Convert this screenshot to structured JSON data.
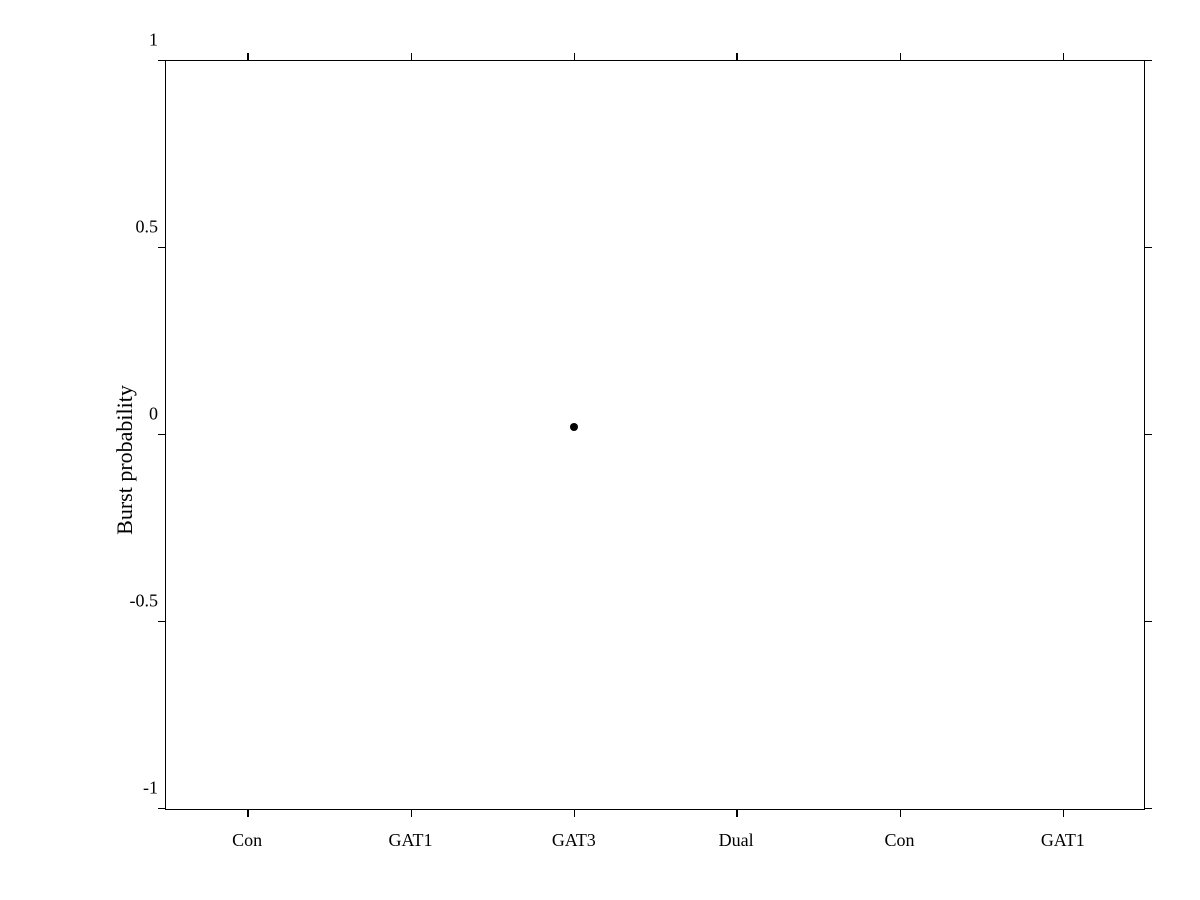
{
  "chart": {
    "y_axis_label": "Burst probability",
    "y_ticks": [
      {
        "value": 1,
        "label": "1"
      },
      {
        "value": 0.5,
        "label": "0.5"
      },
      {
        "value": 0,
        "label": "0"
      },
      {
        "value": -0.5,
        "label": "-0.5"
      },
      {
        "value": -1,
        "label": "-1"
      }
    ],
    "x_ticks": [
      {
        "label": "Con",
        "position_pct": 8.3
      },
      {
        "label": "GAT1",
        "position_pct": 25
      },
      {
        "label": "GAT3",
        "position_pct": 41.7
      },
      {
        "label": "Dual",
        "position_pct": 58.3
      },
      {
        "label": "Con",
        "position_pct": 75
      },
      {
        "label": "GAT1",
        "position_pct": 91.7
      }
    ],
    "data_points": [
      {
        "x_pct": 41.7,
        "y_value": 0.0
      }
    ],
    "y_min": -1,
    "y_max": 1
  }
}
